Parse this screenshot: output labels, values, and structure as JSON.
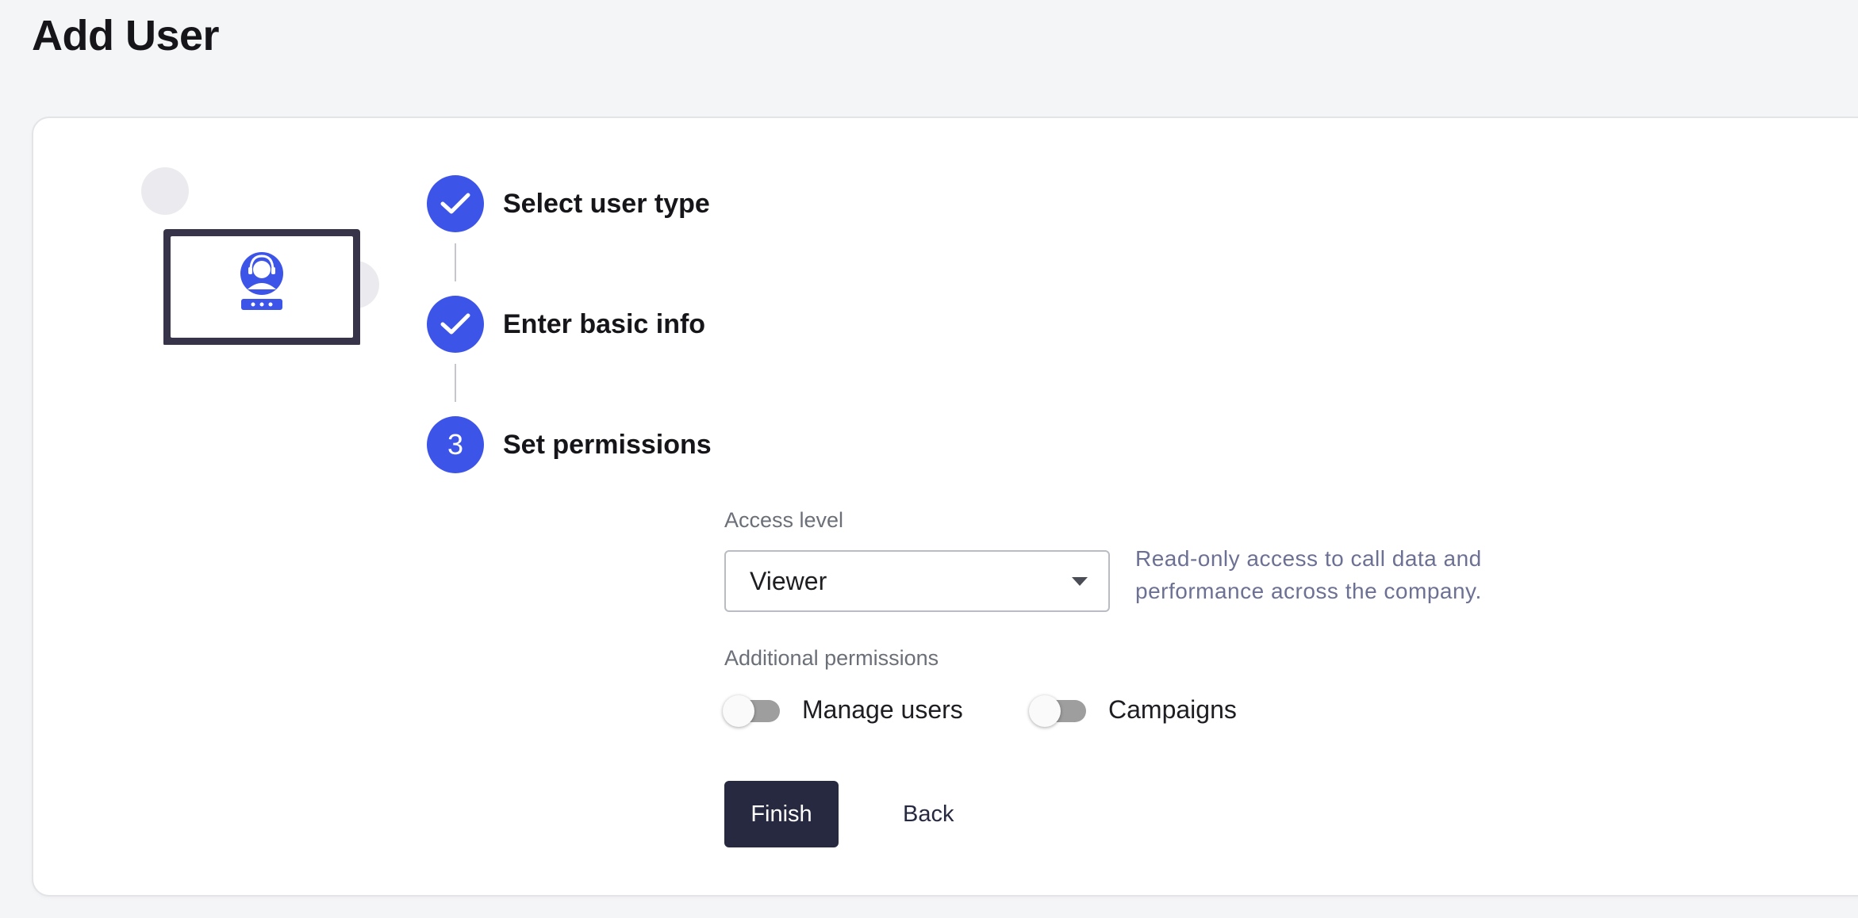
{
  "page": {
    "title": "Add User"
  },
  "stepper": {
    "steps": [
      {
        "label": "Select user type",
        "status": "complete"
      },
      {
        "label": "Enter basic info",
        "status": "complete"
      },
      {
        "label": "Set permissions",
        "status": "current",
        "number": "3"
      }
    ]
  },
  "form": {
    "access_level": {
      "label": "Access level",
      "selected": "Viewer",
      "helper": "Read-only access to call data and performance across the company."
    },
    "additional_permissions": {
      "label": "Additional permissions",
      "toggles": [
        {
          "label": "Manage users",
          "on": false
        },
        {
          "label": "Campaigns",
          "on": false
        }
      ]
    },
    "finish_label": "Finish",
    "back_label": "Back"
  },
  "colors": {
    "accent": "#3d54e8",
    "primary_button": "#262940",
    "helper_text": "#6c7194"
  },
  "icons": {
    "illustration": "monitor-support-agent-icon",
    "step_complete": "check-icon",
    "select_caret": "caret-down-icon"
  }
}
